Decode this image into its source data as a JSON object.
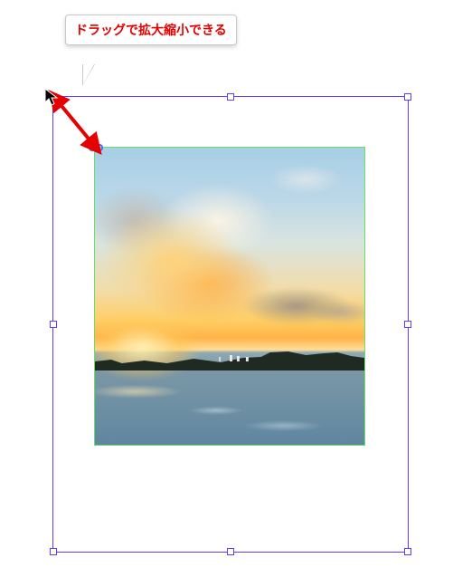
{
  "tooltip": {
    "text": "ドラッグで拡大縮小できる"
  },
  "icons": {
    "content_link": "content-link-icon",
    "cursor": "cursor-arrow-icon"
  },
  "colors": {
    "selection_border": "#5a3fff",
    "content_border": "#66e066",
    "annotation": "#e60000"
  }
}
